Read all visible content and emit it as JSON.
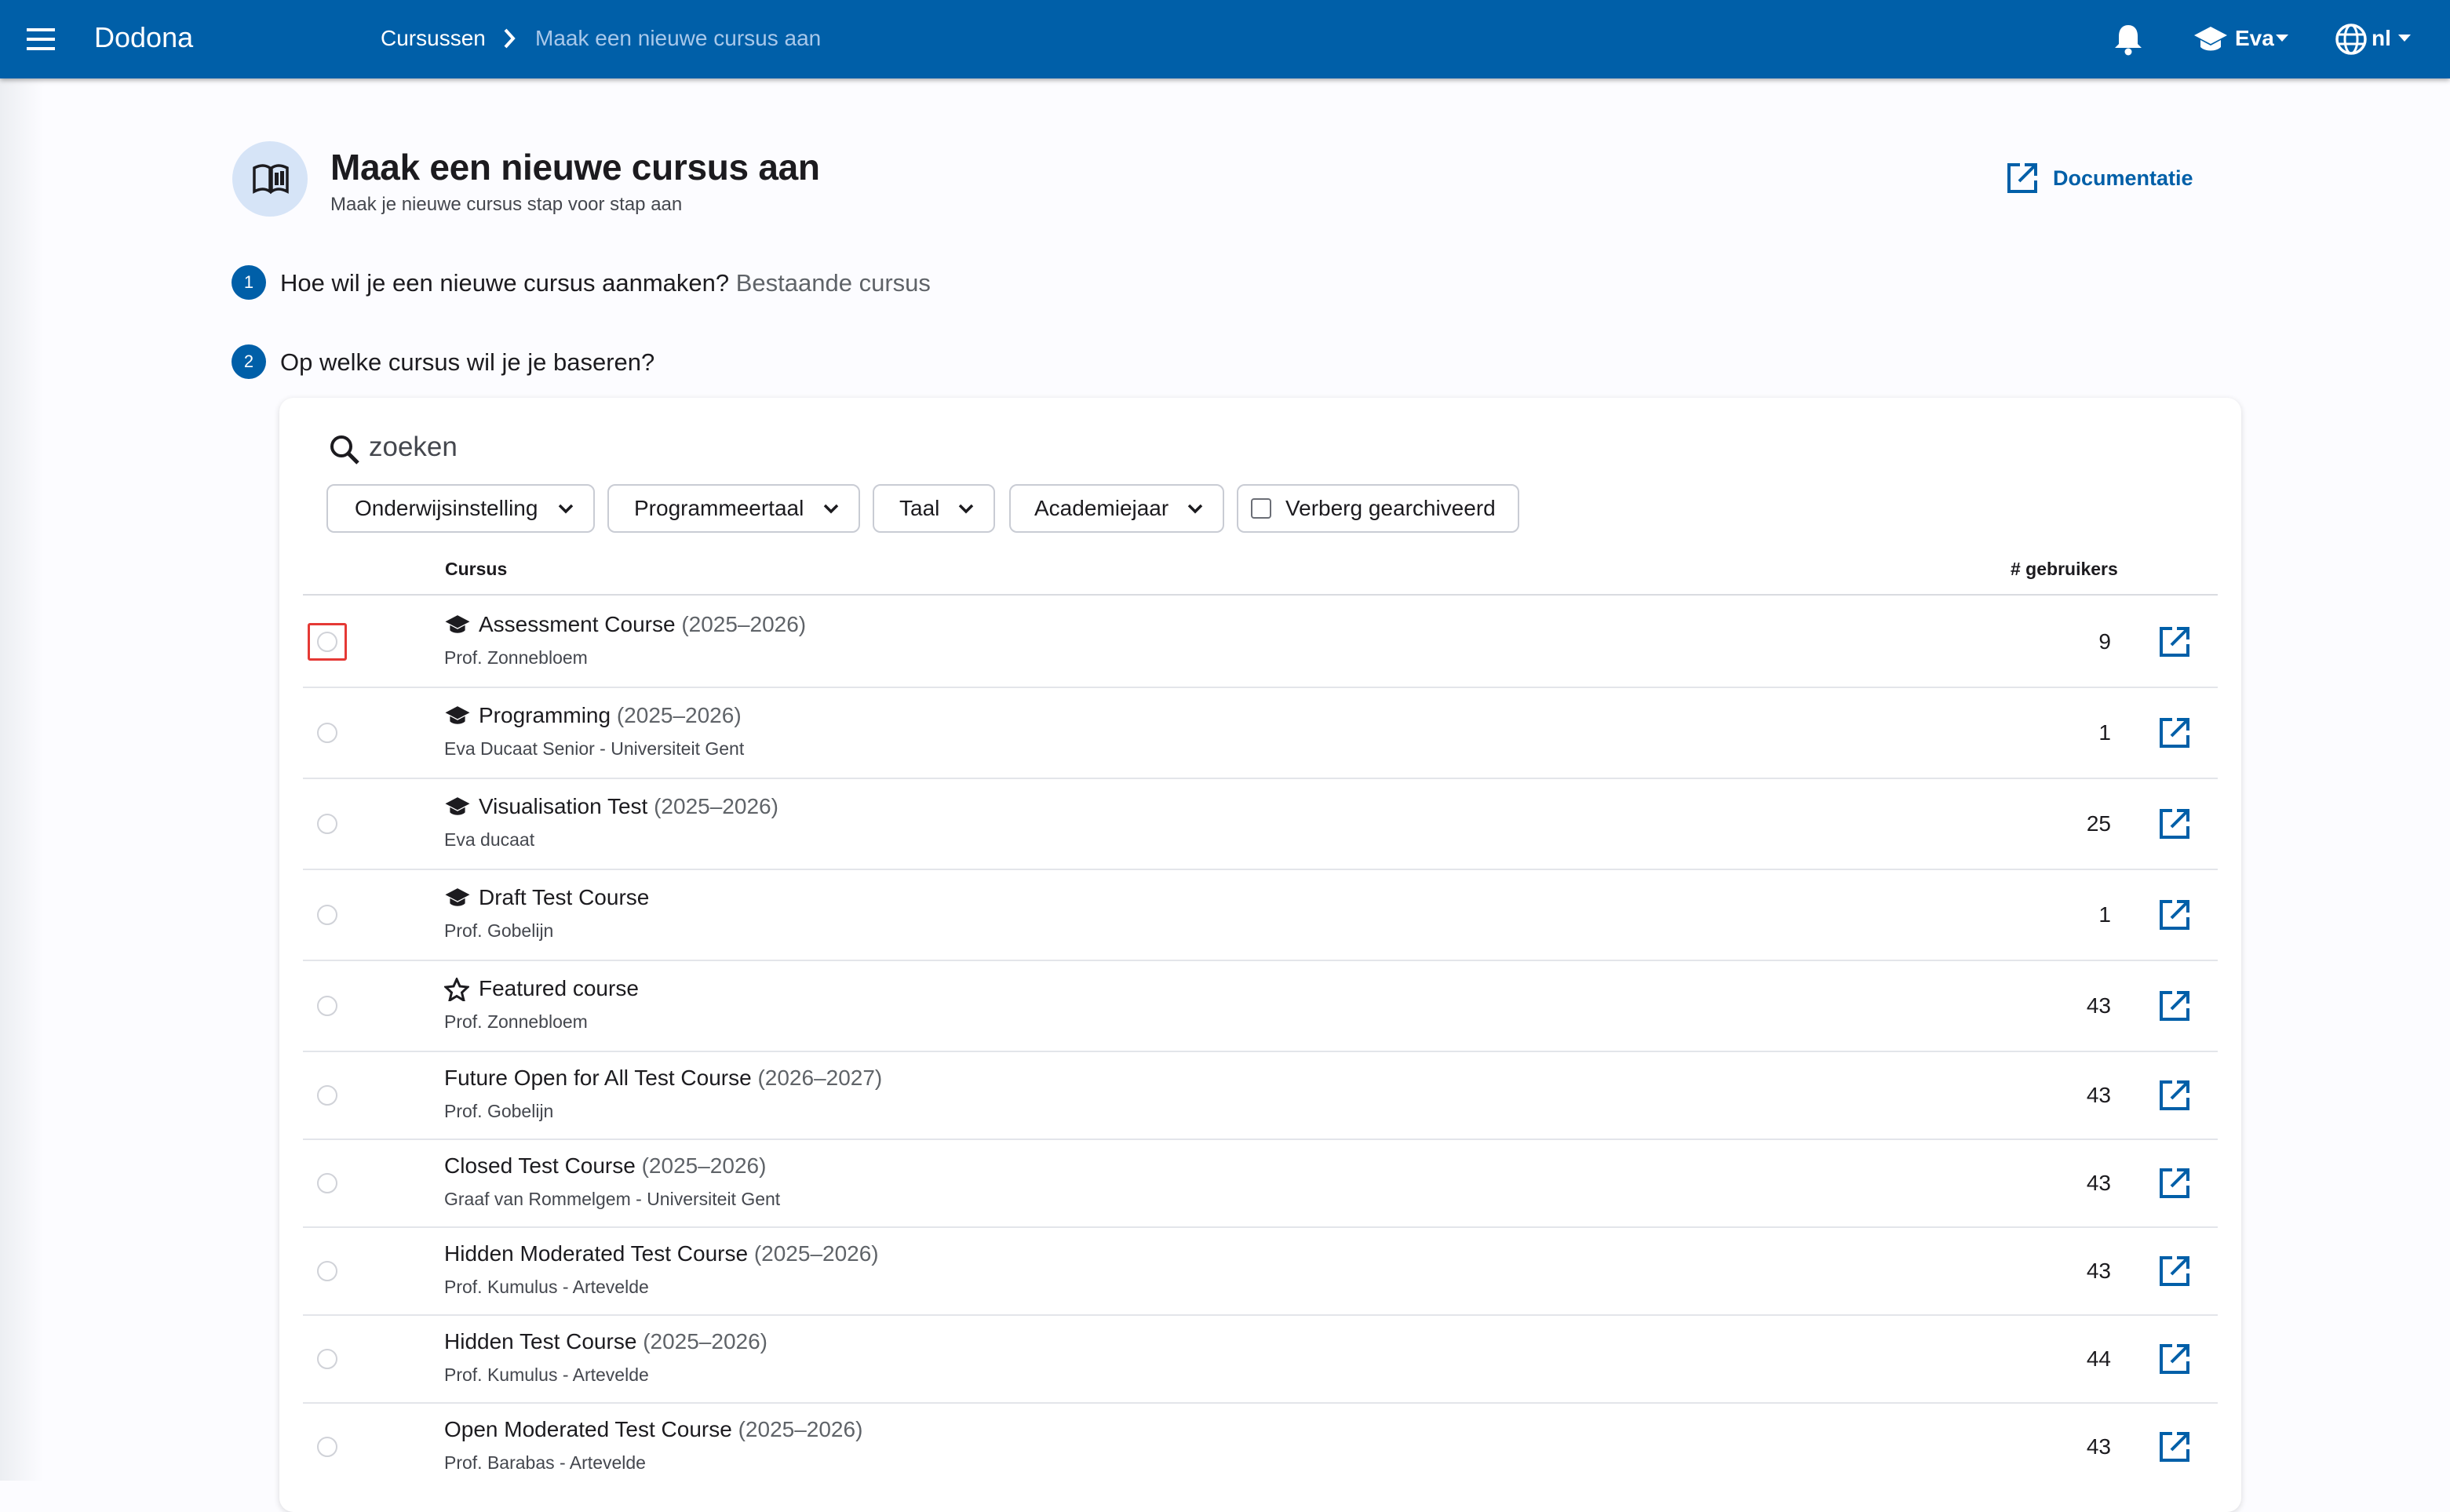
{
  "app": {
    "name": "Dodona",
    "breadcrumb": [
      "Cursussen",
      "Maak een nieuwe cursus aan"
    ],
    "user": "Eva",
    "language": "nl"
  },
  "header": {
    "title": "Maak een nieuwe cursus aan",
    "subtitle": "Maak je nieuwe cursus stap voor stap aan",
    "docs_label": "Documentatie"
  },
  "steps": [
    {
      "number": "1",
      "question": "Hoe wil je een nieuwe cursus aanmaken?",
      "answer": "Bestaande cursus"
    },
    {
      "number": "2",
      "question": "Op welke cursus wil je je baseren?",
      "answer": ""
    }
  ],
  "search": {
    "placeholder": "zoeken"
  },
  "filters": {
    "institution": "Onderwijsinstelling",
    "programming_language": "Programmeertaal",
    "language": "Taal",
    "academic_year": "Academiejaar",
    "hide_archived": "Verberg gearchiveerd"
  },
  "table": {
    "col_course": "Cursus",
    "col_users": "# gebruikers",
    "rows": [
      {
        "name": "Assessment Course",
        "year": "(2025–2026)",
        "teacher": "Prof. Zonnebloem",
        "users": "9",
        "icon": "school-icon"
      },
      {
        "name": "Programming",
        "year": "(2025–2026)",
        "teacher": "Eva Ducaat Senior - Universiteit Gent",
        "users": "1",
        "icon": "school-icon"
      },
      {
        "name": "Visualisation Test",
        "year": "(2025–2026)",
        "teacher": "Eva ducaat",
        "users": "25",
        "icon": "school-icon"
      },
      {
        "name": "Draft Test Course",
        "year": "",
        "teacher": "Prof. Gobelijn",
        "users": "1",
        "icon": "school-icon"
      },
      {
        "name": "Featured course",
        "year": "",
        "teacher": "Prof. Zonnebloem",
        "users": "43",
        "icon": "star-outline-icon"
      },
      {
        "name": "Future Open for All Test Course",
        "year": "(2026–2027)",
        "teacher": "Prof. Gobelijn",
        "users": "43",
        "icon": ""
      },
      {
        "name": "Closed Test Course",
        "year": "(2025–2026)",
        "teacher": "Graaf van Rommelgem - Universiteit Gent",
        "users": "43",
        "icon": ""
      },
      {
        "name": "Hidden Moderated Test Course",
        "year": "(2025–2026)",
        "teacher": "Prof. Kumulus - Artevelde",
        "users": "43",
        "icon": ""
      },
      {
        "name": "Hidden Test Course",
        "year": "(2025–2026)",
        "teacher": "Prof. Kumulus - Artevelde",
        "users": "44",
        "icon": ""
      },
      {
        "name": "Open Moderated Test Course",
        "year": "(2025–2026)",
        "teacher": "Prof. Barabas - Artevelde",
        "users": "43",
        "icon": ""
      }
    ]
  },
  "colors": {
    "primary": "#005fa8",
    "focus": "#e53935"
  }
}
